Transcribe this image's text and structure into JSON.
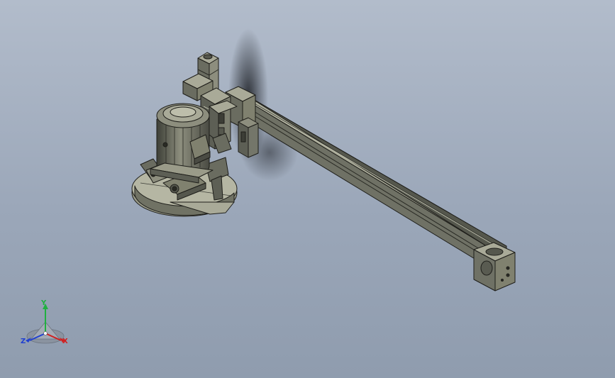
{
  "viewport": {
    "background_top": "#b2bccb",
    "background_bottom": "#8f9cae"
  },
  "model": {
    "parts": [
      "linear-rail-axis",
      "servo-motor",
      "grinder-motor",
      "grinding-wheel-guard",
      "rail-end-cap"
    ],
    "colors": {
      "steel": "#6f7165",
      "steel_light": "#a9aa98",
      "steel_dark": "#3c3d36",
      "outline": "#1e1e1a"
    }
  },
  "triad": {
    "x_label": "X",
    "y_label": "Y",
    "z_label": "Z",
    "x_color": "#d02020",
    "y_color": "#20b040",
    "z_color": "#2040d0"
  }
}
